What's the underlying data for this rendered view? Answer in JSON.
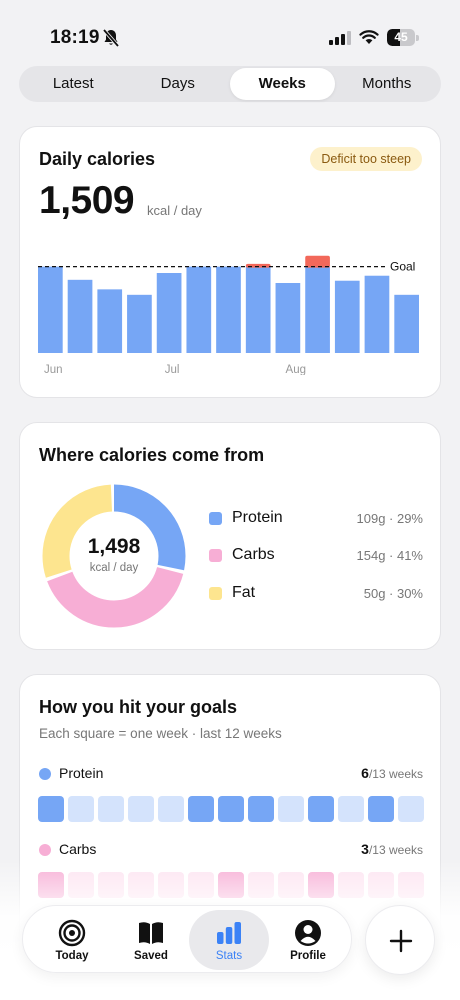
{
  "status_bar": {
    "time": "18:19",
    "battery": "45",
    "battery_level": 0.45
  },
  "segmented": {
    "tabs": [
      "Latest",
      "Days",
      "Weeks",
      "Months"
    ],
    "active": "Weeks"
  },
  "daily_calories": {
    "title": "Daily calories",
    "badge": "Deficit too steep",
    "value": "1,509",
    "unit": "kcal / day",
    "goal_label": "Goal"
  },
  "macros": {
    "title": "Where calories come from",
    "total": "1,498",
    "unit": "kcal / day",
    "items": [
      {
        "name": "Protein",
        "detail": "109g · 29%",
        "color": "#76a6f5",
        "percent": 29
      },
      {
        "name": "Carbs",
        "detail": "154g · 41%",
        "color": "#f7aed5",
        "percent": 41
      },
      {
        "name": "Fat",
        "detail": "50g · 30%",
        "color": "#fde58f",
        "percent": 30
      }
    ]
  },
  "goals": {
    "title": "How you hit your goals",
    "subtitle": "Each square = one week · last 12 weeks",
    "rows": [
      {
        "name": "Protein",
        "hit": "6",
        "total": "/13 weeks",
        "color": "#76a6f5",
        "on_color": "#76a6f5",
        "off_color": "#d4e3fc",
        "weeks": [
          1,
          0,
          0,
          0,
          0,
          1,
          1,
          1,
          0,
          1,
          0,
          1,
          0
        ]
      },
      {
        "name": "Carbs",
        "hit": "3",
        "total": "/13 weeks",
        "color": "#f7aed5",
        "on_color": "#f7aed5",
        "off_color": "#fde4f1",
        "weeks": [
          1,
          0,
          0,
          0,
          0,
          0,
          1,
          0,
          0,
          1,
          0,
          0,
          0
        ]
      }
    ]
  },
  "tabbar": {
    "items": [
      {
        "label": "Today",
        "icon": "target-icon"
      },
      {
        "label": "Saved",
        "icon": "book-icon"
      },
      {
        "label": "Stats",
        "icon": "bar-chart-icon"
      },
      {
        "label": "Profile",
        "icon": "user-icon"
      }
    ],
    "active": "Stats"
  },
  "colors": {
    "accent": "#3b82f6",
    "bar": "#76a6f5",
    "over": "#f2685a"
  },
  "chart_data": {
    "type": "bar",
    "title": "Daily calories",
    "categories": [
      "",
      "",
      "",
      "",
      "",
      "",
      "",
      "",
      "",
      "",
      "",
      "",
      "",
      ""
    ],
    "tick_labels": [
      "Jun",
      "Jul",
      "Aug"
    ],
    "tick_positions": [
      0,
      4,
      8
    ],
    "values": [
      1900,
      1610,
      1400,
      1280,
      1760,
      1900,
      1900,
      1900,
      1540,
      1900,
      1590,
      1700,
      1280
    ],
    "over_goal": [
      0,
      0,
      0,
      0,
      0,
      0,
      0,
      60,
      0,
      240,
      0,
      0,
      0
    ],
    "goal": 1900,
    "goal_label": "Goal",
    "ylim": [
      0,
      2200
    ],
    "grid": false
  }
}
